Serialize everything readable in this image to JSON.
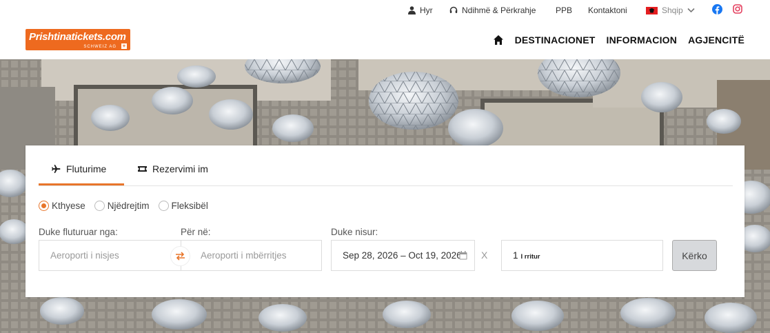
{
  "topbar": {
    "login": "Hyr",
    "help": "Ndihmë & Përkrahje",
    "ppb": "PPB",
    "contact": "Kontaktoni",
    "language": "Shqip"
  },
  "header": {
    "logo_main": "Prishtinatickets.com",
    "logo_sub": "SCHWEIZ AG",
    "nav": [
      "DESTINACIONET",
      "INFORMACION",
      "AGJENCITË"
    ]
  },
  "search": {
    "tabs": [
      "Fluturime",
      "Rezervimi im"
    ],
    "trip_types": [
      "Kthyese",
      "Njëdrejtim",
      "Fleksibël"
    ],
    "selected_trip": "Kthyese",
    "from_label": "Duke fluturuar nga:",
    "to_label": "Për në:",
    "depart_label": "Duke nisur:",
    "from_placeholder": "Aeroporti i nisjes",
    "to_placeholder": "Aeroporti i mbërritjes",
    "dates": "Sep 28, 2026 – Oct 19, 2026",
    "separator": "X",
    "passengers_count": "1",
    "passengers_label": "I rritur",
    "search_button": "Kërko"
  },
  "colors": {
    "accent": "#e8752a",
    "logo": "#ee6a1f",
    "facebook": "#1877f2",
    "instagram": "#e4405f"
  }
}
